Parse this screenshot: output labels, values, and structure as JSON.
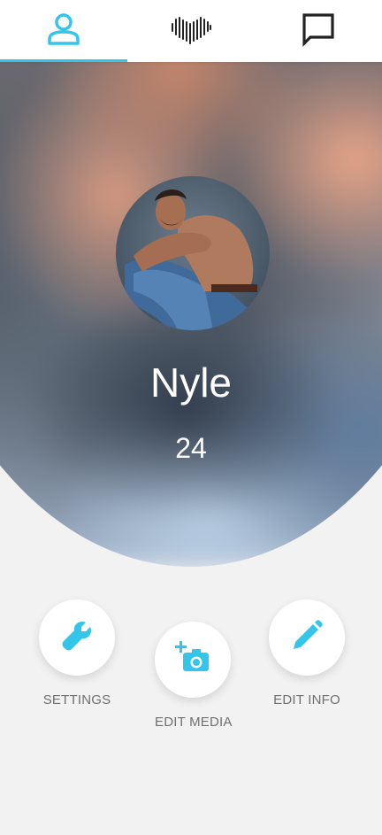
{
  "tabs": [
    {
      "icon": "profile-icon",
      "active": true
    },
    {
      "icon": "heart-pulse-icon",
      "active": false
    },
    {
      "icon": "chat-icon",
      "active": false
    }
  ],
  "profile": {
    "name": "Nyle",
    "age": "24"
  },
  "actions": {
    "settings": {
      "label": "SETTINGS",
      "icon": "wrench-icon"
    },
    "edit_media": {
      "label": "EDIT MEDIA",
      "icon": "add-camera-icon"
    },
    "edit_info": {
      "label": "EDIT INFO",
      "icon": "pencil-icon"
    }
  },
  "colors": {
    "accent": "#33c6ea",
    "background": "#f2f2f2",
    "label": "#6f6f6f"
  }
}
